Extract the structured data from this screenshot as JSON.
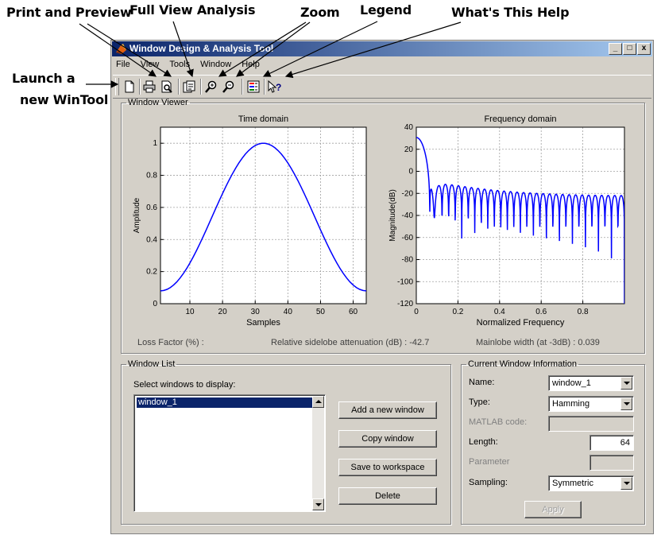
{
  "callouts": {
    "print_preview": "Print and Preview",
    "full_view": "Full View Analysis",
    "zoom": "Zoom",
    "legend": "Legend",
    "whats_this": "What's This Help",
    "launch_line1": "Launch a",
    "launch_line2": "new WinTool"
  },
  "window": {
    "title": "Window Design & Analysis Tool",
    "controls": {
      "minimize": "_",
      "maximize": "□",
      "close": "x"
    }
  },
  "menu": [
    "File",
    "View",
    "Tools",
    "Window",
    "Help"
  ],
  "toolbar": {
    "icons": [
      "new-document-icon",
      "print-icon",
      "print-preview-icon",
      "full-view-icon",
      "zoom-in-icon",
      "zoom-out-icon",
      "legend-icon",
      "whats-this-icon"
    ]
  },
  "viewer": {
    "legend": "Window Viewer",
    "loss_factor": "Loss Factor (%) :",
    "sidelobe": "Relative sidelobe attenuation (dB) : -42.7",
    "mainlobe": "Mainlobe width (at -3dB) : 0.039"
  },
  "chart_data": [
    {
      "type": "line",
      "title": "Time domain",
      "xlabel": "Samples",
      "ylabel": "Amplitude",
      "xlim": [
        1,
        64
      ],
      "ylim": [
        0,
        1.1
      ],
      "xticks": [
        10,
        20,
        30,
        40,
        50,
        60
      ],
      "yticks": [
        0,
        0.2,
        0.4,
        0.6,
        0.8,
        1
      ],
      "ytick_labels": [
        "0",
        "0.2",
        "0.4",
        "0.6",
        "0.8",
        "1"
      ],
      "grid": true,
      "series": [
        {
          "window": "Hamming",
          "length": 64,
          "sampling": "Symmetric",
          "color": "#0000ff"
        }
      ]
    },
    {
      "type": "line",
      "title": "Frequency domain",
      "xlabel": "Normalized Frequency",
      "ylabel": "Magnitude(dB)",
      "xlim": [
        0,
        1
      ],
      "ylim": [
        -120,
        40
      ],
      "xticks": [
        0,
        0.2,
        0.4,
        0.6,
        0.8
      ],
      "yticks": [
        -120,
        -100,
        -80,
        -60,
        -40,
        -20,
        0,
        20,
        40
      ],
      "grid": true,
      "series": [
        {
          "window": "Hamming",
          "length": 64,
          "color": "#0000ff"
        }
      ]
    }
  ],
  "window_list": {
    "legend": "Window List",
    "prompt": "Select windows to display:",
    "items": [
      "window_1"
    ],
    "buttons": {
      "add": "Add a new window",
      "copy": "Copy window",
      "save": "Save to workspace",
      "delete": "Delete"
    }
  },
  "current_window": {
    "legend": "Current Window Information",
    "name_label": "Name:",
    "name_value": "window_1",
    "type_label": "Type:",
    "type_value": "Hamming",
    "matlab_label": "MATLAB code:",
    "matlab_value": "",
    "length_label": "Length:",
    "length_value": "64",
    "parameter_label": "Parameter",
    "parameter_value": "",
    "sampling_label": "Sampling:",
    "sampling_value": "Symmetric",
    "apply": "Apply"
  }
}
